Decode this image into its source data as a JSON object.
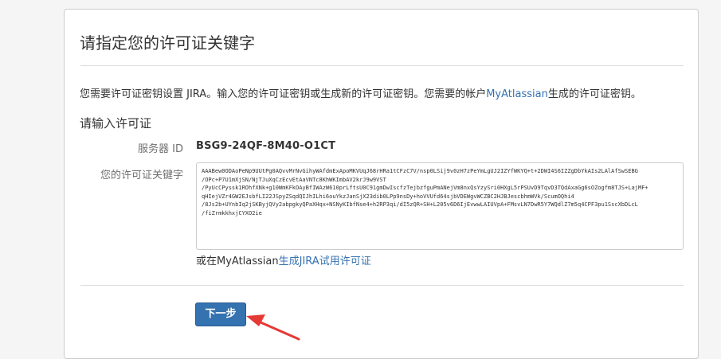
{
  "page": {
    "title": "请指定您的许可证关键字",
    "description_prefix": "您需要许可证密钥设置 JIRA。输入您的许可证密钥或生成新的许可证密钥。您需要的帐户",
    "description_link": "MyAtlassian",
    "description_suffix": "生成的许可证密钥。"
  },
  "form": {
    "section_title": "请输入许可证",
    "server_id_label": "服务器 ID",
    "server_id_value": "BSG9-24QF-8M40-O1CT",
    "license_label": "您的许可证关键字",
    "license_value": "AAABew0ODAoPeNp9UUtPg0AQvvMrNvGihyWAfdmExApoMKVUqJ68rHRa1tCFzC7V/nsp0LSij9v0zH7zPeYmLgUJ2IZYfWKYQ+t+2DWI4S6IZZgDbYkAIs2LAlAfSwSEBG\n/OPc+P7U1mXjSN/NjTJuXqCzEcvEtAaVNTc8KhWKImbAV2krJ9w9VST\n/PyUcCPyssk1ROhfXNk+g10WmKFkOAyBfIWAzW610prLftsU0C91gmDwIscfzTejbzfguPmANejVm8nxQsYzySri0HXgL5rPSUvD9TqvD3TQdAxaGg6sOZogfm8TJS+LajMF+\nqHIejVZr4GW2EJsbfLI22JSpyZSqdQIJhILhi6ouYkzJanSjX23dib0LPp9nsDy+hoVVUfd64sjbVDEWgvWCZBC2HJBJescbhmWVk/ScumOQhi4\n/8Js2b+UYnbIq2jSKByjQVy2abpgkyQPaXHqx+NSNyKIbfNse4+h2RP3qi/dI5zQR+SH+L205v6D6IjEvwwLAIUVpA+FMsvLN7DwR5Y7WQdlZ7m5q4CPF3pu1SscXbDLcL\n/fiZrmkkhxjCYXO2ie",
    "trial_prefix": "或在MyAtlassian",
    "trial_link": "生成JIRA试用许可证"
  },
  "actions": {
    "next_label": "下一步"
  },
  "annotation": {
    "arrow_color": "#e53935",
    "arrow_icon": "red-arrow-icon"
  },
  "colors": {
    "link": "#3572b0",
    "primary_button": "#3572b0"
  }
}
